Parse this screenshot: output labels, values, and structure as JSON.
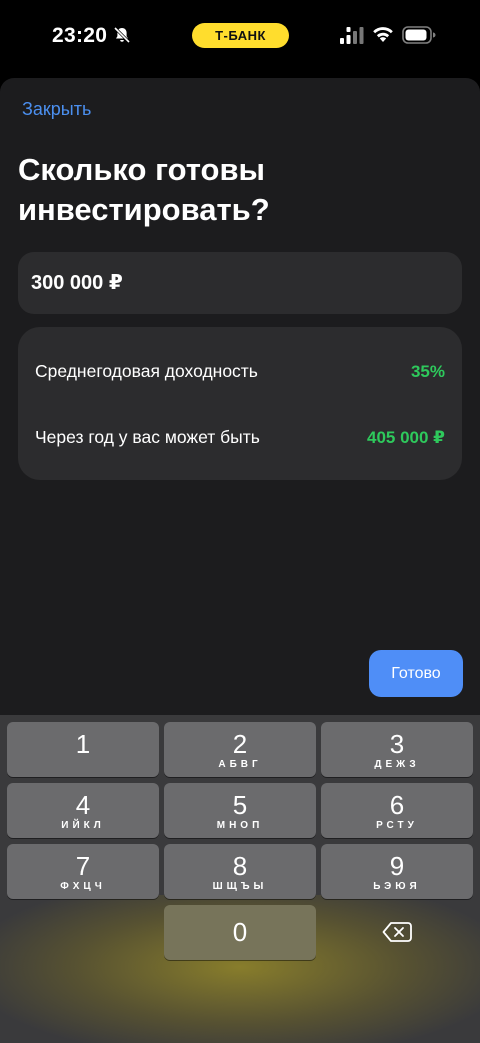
{
  "status_bar": {
    "time": "23:20",
    "bank_label": "Т-БАНК",
    "icons": [
      "bell-slash-icon",
      "signal-icon",
      "wifi-icon",
      "battery-icon"
    ]
  },
  "sheet": {
    "close_label": "Закрыть",
    "title": "Сколько готовы инвестировать?",
    "amount_value": "300 000 ₽",
    "info": {
      "yield_label": "Среднегодовая доходность",
      "yield_value": "35%",
      "future_label": "Через год у вас может быть",
      "future_value": "405 000 ₽"
    },
    "done_label": "Готово"
  },
  "keyboard": {
    "keys": [
      {
        "digit": "1",
        "letters": ""
      },
      {
        "digit": "2",
        "letters": "АБВГ"
      },
      {
        "digit": "3",
        "letters": "ДЕЖЗ"
      },
      {
        "digit": "4",
        "letters": "ИЙКЛ"
      },
      {
        "digit": "5",
        "letters": "МНОП"
      },
      {
        "digit": "6",
        "letters": "РСТУ"
      },
      {
        "digit": "7",
        "letters": "ФХЦЧ"
      },
      {
        "digit": "8",
        "letters": "ШЩЪЫ"
      },
      {
        "digit": "9",
        "letters": "ЬЭЮЯ"
      },
      {
        "digit": "0",
        "letters": ""
      }
    ],
    "backspace_icon": "backspace-icon"
  },
  "colors": {
    "accent_blue": "#4b8fef",
    "positive_green": "#2ec95c",
    "brand_yellow": "#ffdd2d",
    "sheet_bg": "#1c1c1e",
    "card_bg": "#2c2c2e"
  }
}
